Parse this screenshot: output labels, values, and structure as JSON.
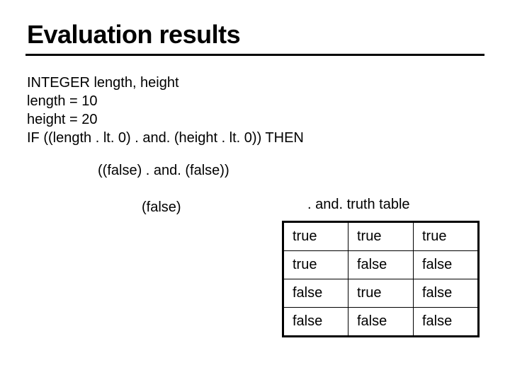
{
  "title": "Evaluation results",
  "code": {
    "line1": "INTEGER length, height",
    "line2": "length = 10",
    "line3": "height = 20",
    "line4": "IF ((length . lt. 0) . and. (height . lt. 0)) THEN"
  },
  "eval": {
    "step1": "((false) . and. (false))",
    "step2": "(false)"
  },
  "table": {
    "caption": ". and. truth table",
    "rows": [
      [
        "true",
        "true",
        "true"
      ],
      [
        "true",
        "false",
        "false"
      ],
      [
        "false",
        "true",
        "false"
      ],
      [
        "false",
        "false",
        "false"
      ]
    ]
  }
}
